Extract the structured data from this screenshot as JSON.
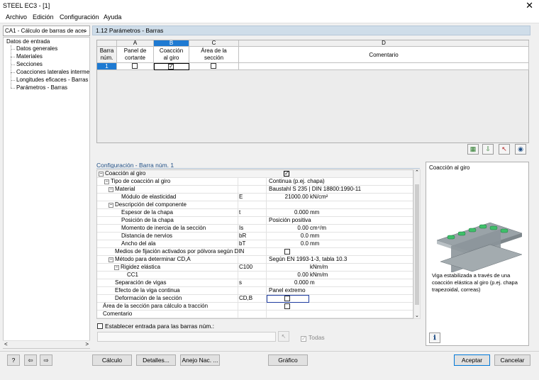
{
  "window": {
    "title": "STEEL EC3 - [1]",
    "close_label": "✕"
  },
  "menu": [
    "Archivo",
    "Edición",
    "Configuración",
    "Ayuda"
  ],
  "nav": {
    "combo_value": "CA1 - Cálculo de barras de acer",
    "root": "Datos de entrada",
    "items": [
      "Datos generales",
      "Materiales",
      "Secciones",
      "Coacciones laterales intermedi",
      "Longitudes eficaces - Barras",
      "Parámetros - Barras"
    ]
  },
  "main_header": "1.12 Parámetros - Barras",
  "grid": {
    "col_letters": [
      "A",
      "B",
      "C",
      "D"
    ],
    "row_header": [
      "Barra",
      "núm."
    ],
    "col_A": [
      "Panel de",
      "cortante"
    ],
    "col_B": [
      "Coacción",
      "al giro"
    ],
    "col_C": [
      "Área de la",
      "sección"
    ],
    "col_D": "Comentario",
    "row_num": "1"
  },
  "config": {
    "header": "Configuración - Barra núm. 1",
    "rows": [
      {
        "label": "Coacción al giro",
        "sym": "",
        "value": "",
        "text": "",
        "unit": ""
      },
      {
        "label": "Tipo de coacción al giro",
        "sym": "",
        "value": "",
        "text": "Continua (p.ej. chapa)",
        "unit": ""
      },
      {
        "label": "Material",
        "sym": "",
        "value": "",
        "text": "Baustahl S 235 | DIN 18800:1990-11",
        "unit": ""
      },
      {
        "label": "Módulo de elasticidad",
        "sym": "E",
        "value": "21000.00",
        "text": "",
        "unit": "kN/cm²"
      },
      {
        "label": "Descripción del componente",
        "sym": "",
        "value": "",
        "text": "",
        "unit": ""
      },
      {
        "label": "Espesor de la chapa",
        "sym": "t",
        "value": "0.000",
        "text": "",
        "unit": "mm"
      },
      {
        "label": "Posición de la chapa",
        "sym": "",
        "value": "",
        "text": "Posición positiva",
        "unit": ""
      },
      {
        "label": "Momento de inercia de la sección",
        "sym": "Is",
        "value": "0.00",
        "text": "",
        "unit": "cm⁴/m"
      },
      {
        "label": "Distancia de nervios",
        "sym": "bR",
        "value": "0.0",
        "text": "",
        "unit": "mm"
      },
      {
        "label": "Ancho del ala",
        "sym": "bT",
        "value": "0.0",
        "text": "",
        "unit": "mm"
      },
      {
        "label": "Medios de fijación activados por pólvora según DIN",
        "sym": "",
        "value": "",
        "text": "",
        "unit": ""
      },
      {
        "label": "Método para determinar CD,A",
        "sym": "",
        "value": "",
        "text": "Según EN 1993-1-3, tabla 10.3",
        "unit": ""
      },
      {
        "label": "Rigidez elástica",
        "sym": "C100",
        "value": "",
        "text": "",
        "unit": "kNm/m"
      },
      {
        "label": "CC1",
        "sym": "",
        "value": "0.00",
        "text": "",
        "unit": "kNm/m"
      },
      {
        "label": "Separación de vigas",
        "sym": "s",
        "value": "0.000",
        "text": "",
        "unit": "m"
      },
      {
        "label": "Efecto de la viga continua",
        "sym": "",
        "value": "",
        "text": "Panel extremo",
        "unit": ""
      },
      {
        "label": "Deformación de la sección",
        "sym": "CD,B",
        "value": "",
        "text": "",
        "unit": ""
      },
      {
        "label": "Área de la sección para cálculo a tracción",
        "sym": "",
        "value": "",
        "text": "",
        "unit": ""
      },
      {
        "label": "Comentario",
        "sym": "",
        "value": "",
        "text": "",
        "unit": ""
      }
    ]
  },
  "info": {
    "title": "Coacción al giro",
    "description": "Viga estabilizada a través de una coacción elástica al giro (p.ej. chapa trapezoidal, correas)"
  },
  "bottom": {
    "set_all_label": "Establecer entrada para las barras núm.:",
    "todas_label": "Todas"
  },
  "footer": {
    "calc": "Cálculo",
    "details": "Detalles...",
    "annex": "Anejo Nac. ...",
    "graphic": "Gráfico",
    "accept": "Aceptar",
    "cancel": "Cancelar"
  },
  "colors": {
    "header_bg": "#cfdde9",
    "accent": "#1f4e85",
    "selected_col": "#1e7ad2"
  }
}
